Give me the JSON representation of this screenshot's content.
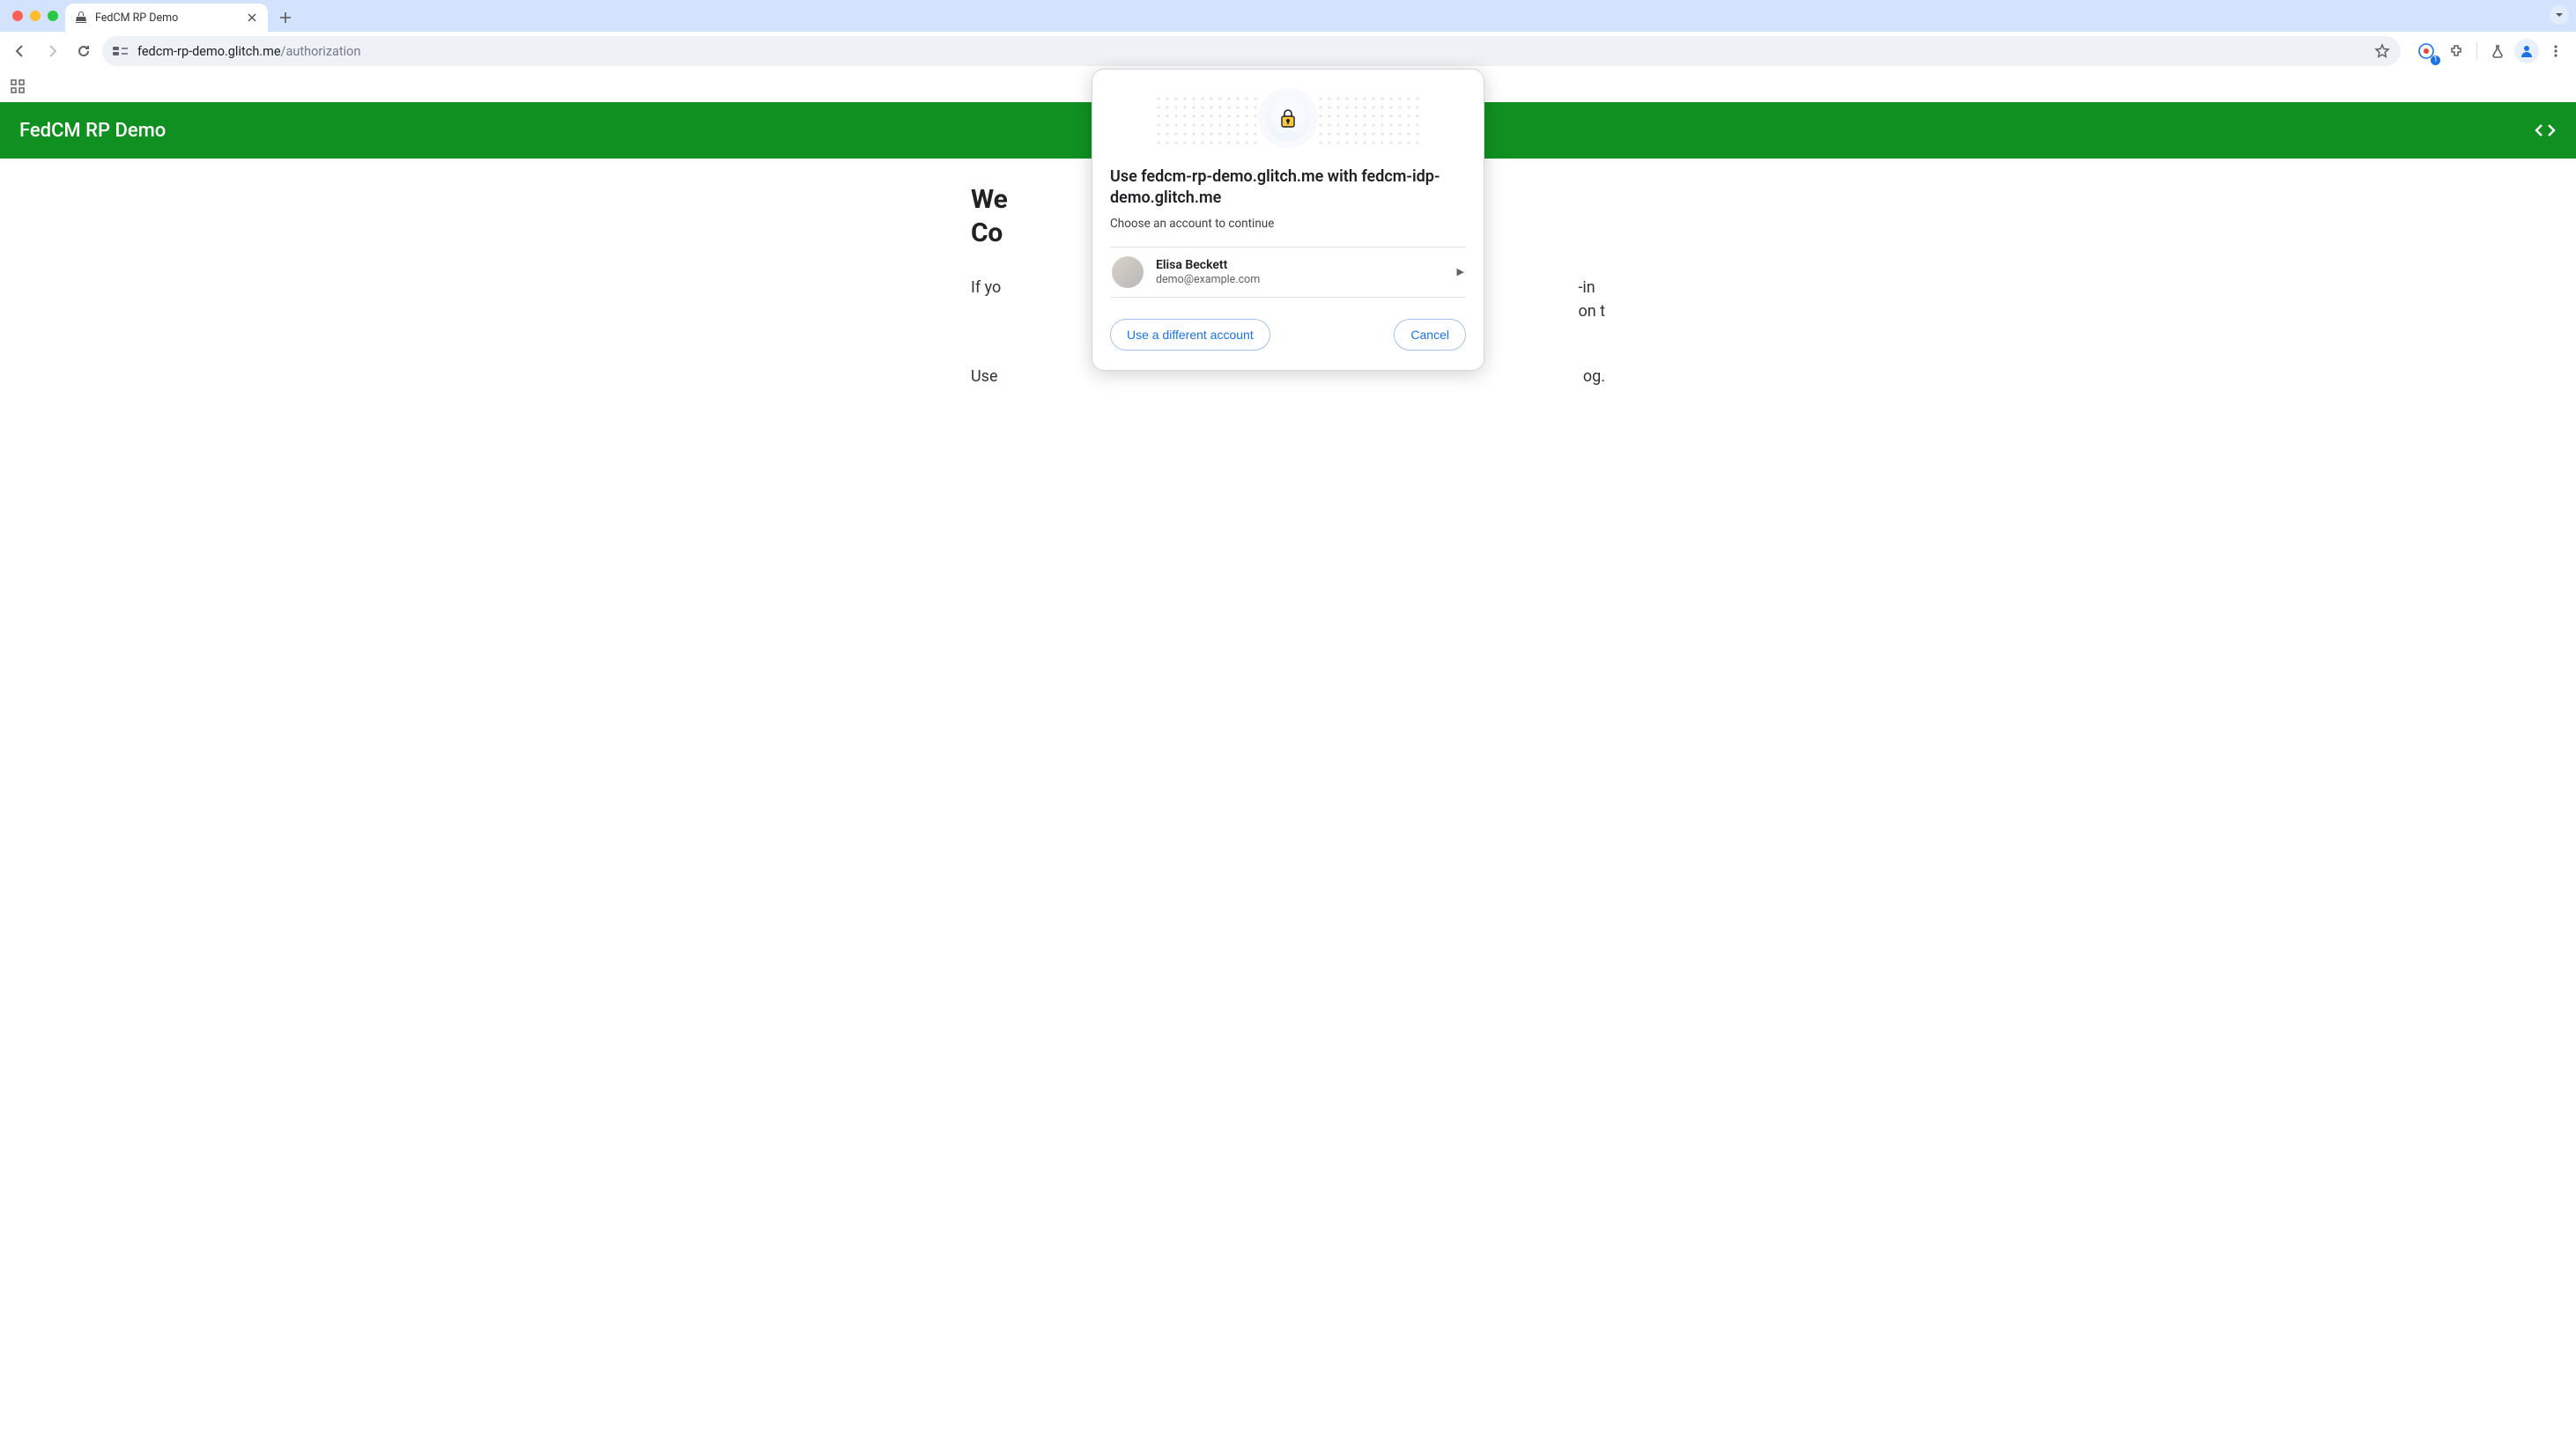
{
  "browser": {
    "tab_title": "FedCM RP Demo",
    "url_host": "fedcm-rp-demo.glitch.me",
    "url_path": "/authorization",
    "devtools_badge": "1"
  },
  "page": {
    "header_title": "FedCM RP Demo",
    "heading_visible_fragment_1": "We",
    "heading_visible_fragment_2": "Co",
    "body_visible_prefix": "If yo",
    "body_visible_suffix": "-in\non t",
    "hint_prefix": "Use",
    "hint_suffix": "og."
  },
  "dialog": {
    "title": "Use fedcm-rp-demo.glitch.me with fedcm-idp-demo.glitch.me",
    "subtitle": "Choose an account to continue",
    "accounts": [
      {
        "name": "Elisa Beckett",
        "email": "demo@example.com"
      }
    ],
    "use_different": "Use a different account",
    "cancel": "Cancel"
  }
}
